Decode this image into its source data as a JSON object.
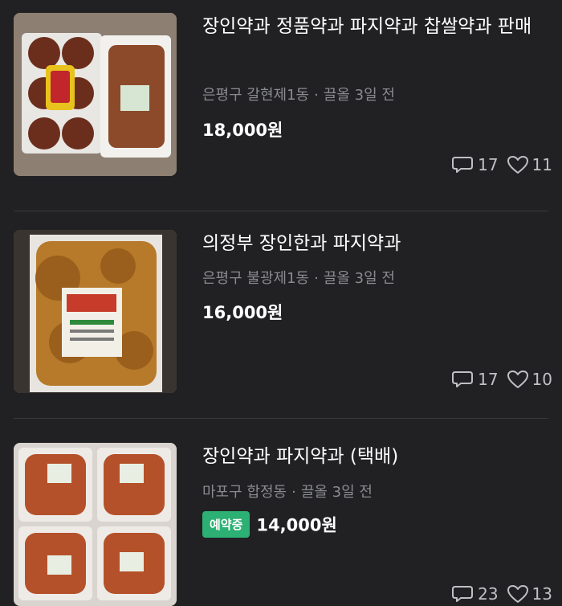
{
  "listings": [
    {
      "title": "장인약과 정품약과 파지약과 찹쌀약과 판매",
      "location": "은평구 갈현제1동",
      "bump": "끌올 3일 전",
      "price": "18,000원",
      "status_badge": "",
      "chats": "17",
      "likes": "11"
    },
    {
      "title": "의정부 장인한과 파지약과",
      "location": "은평구 불광제1동",
      "bump": "끌올 3일 전",
      "price": "16,000원",
      "status_badge": "",
      "chats": "17",
      "likes": "10"
    },
    {
      "title": "장인약과 파지약과 (택배)",
      "location": "마포구 합정동",
      "bump": "끌올 3일 전",
      "price": "14,000원",
      "status_badge": "예약중",
      "chats": "23",
      "likes": "13"
    }
  ],
  "icons": {
    "chat": "chat-bubble-icon",
    "like": "heart-icon"
  },
  "colors": {
    "background": "#212124",
    "badge": "#2cb073",
    "meta": "#8a8b8f"
  }
}
